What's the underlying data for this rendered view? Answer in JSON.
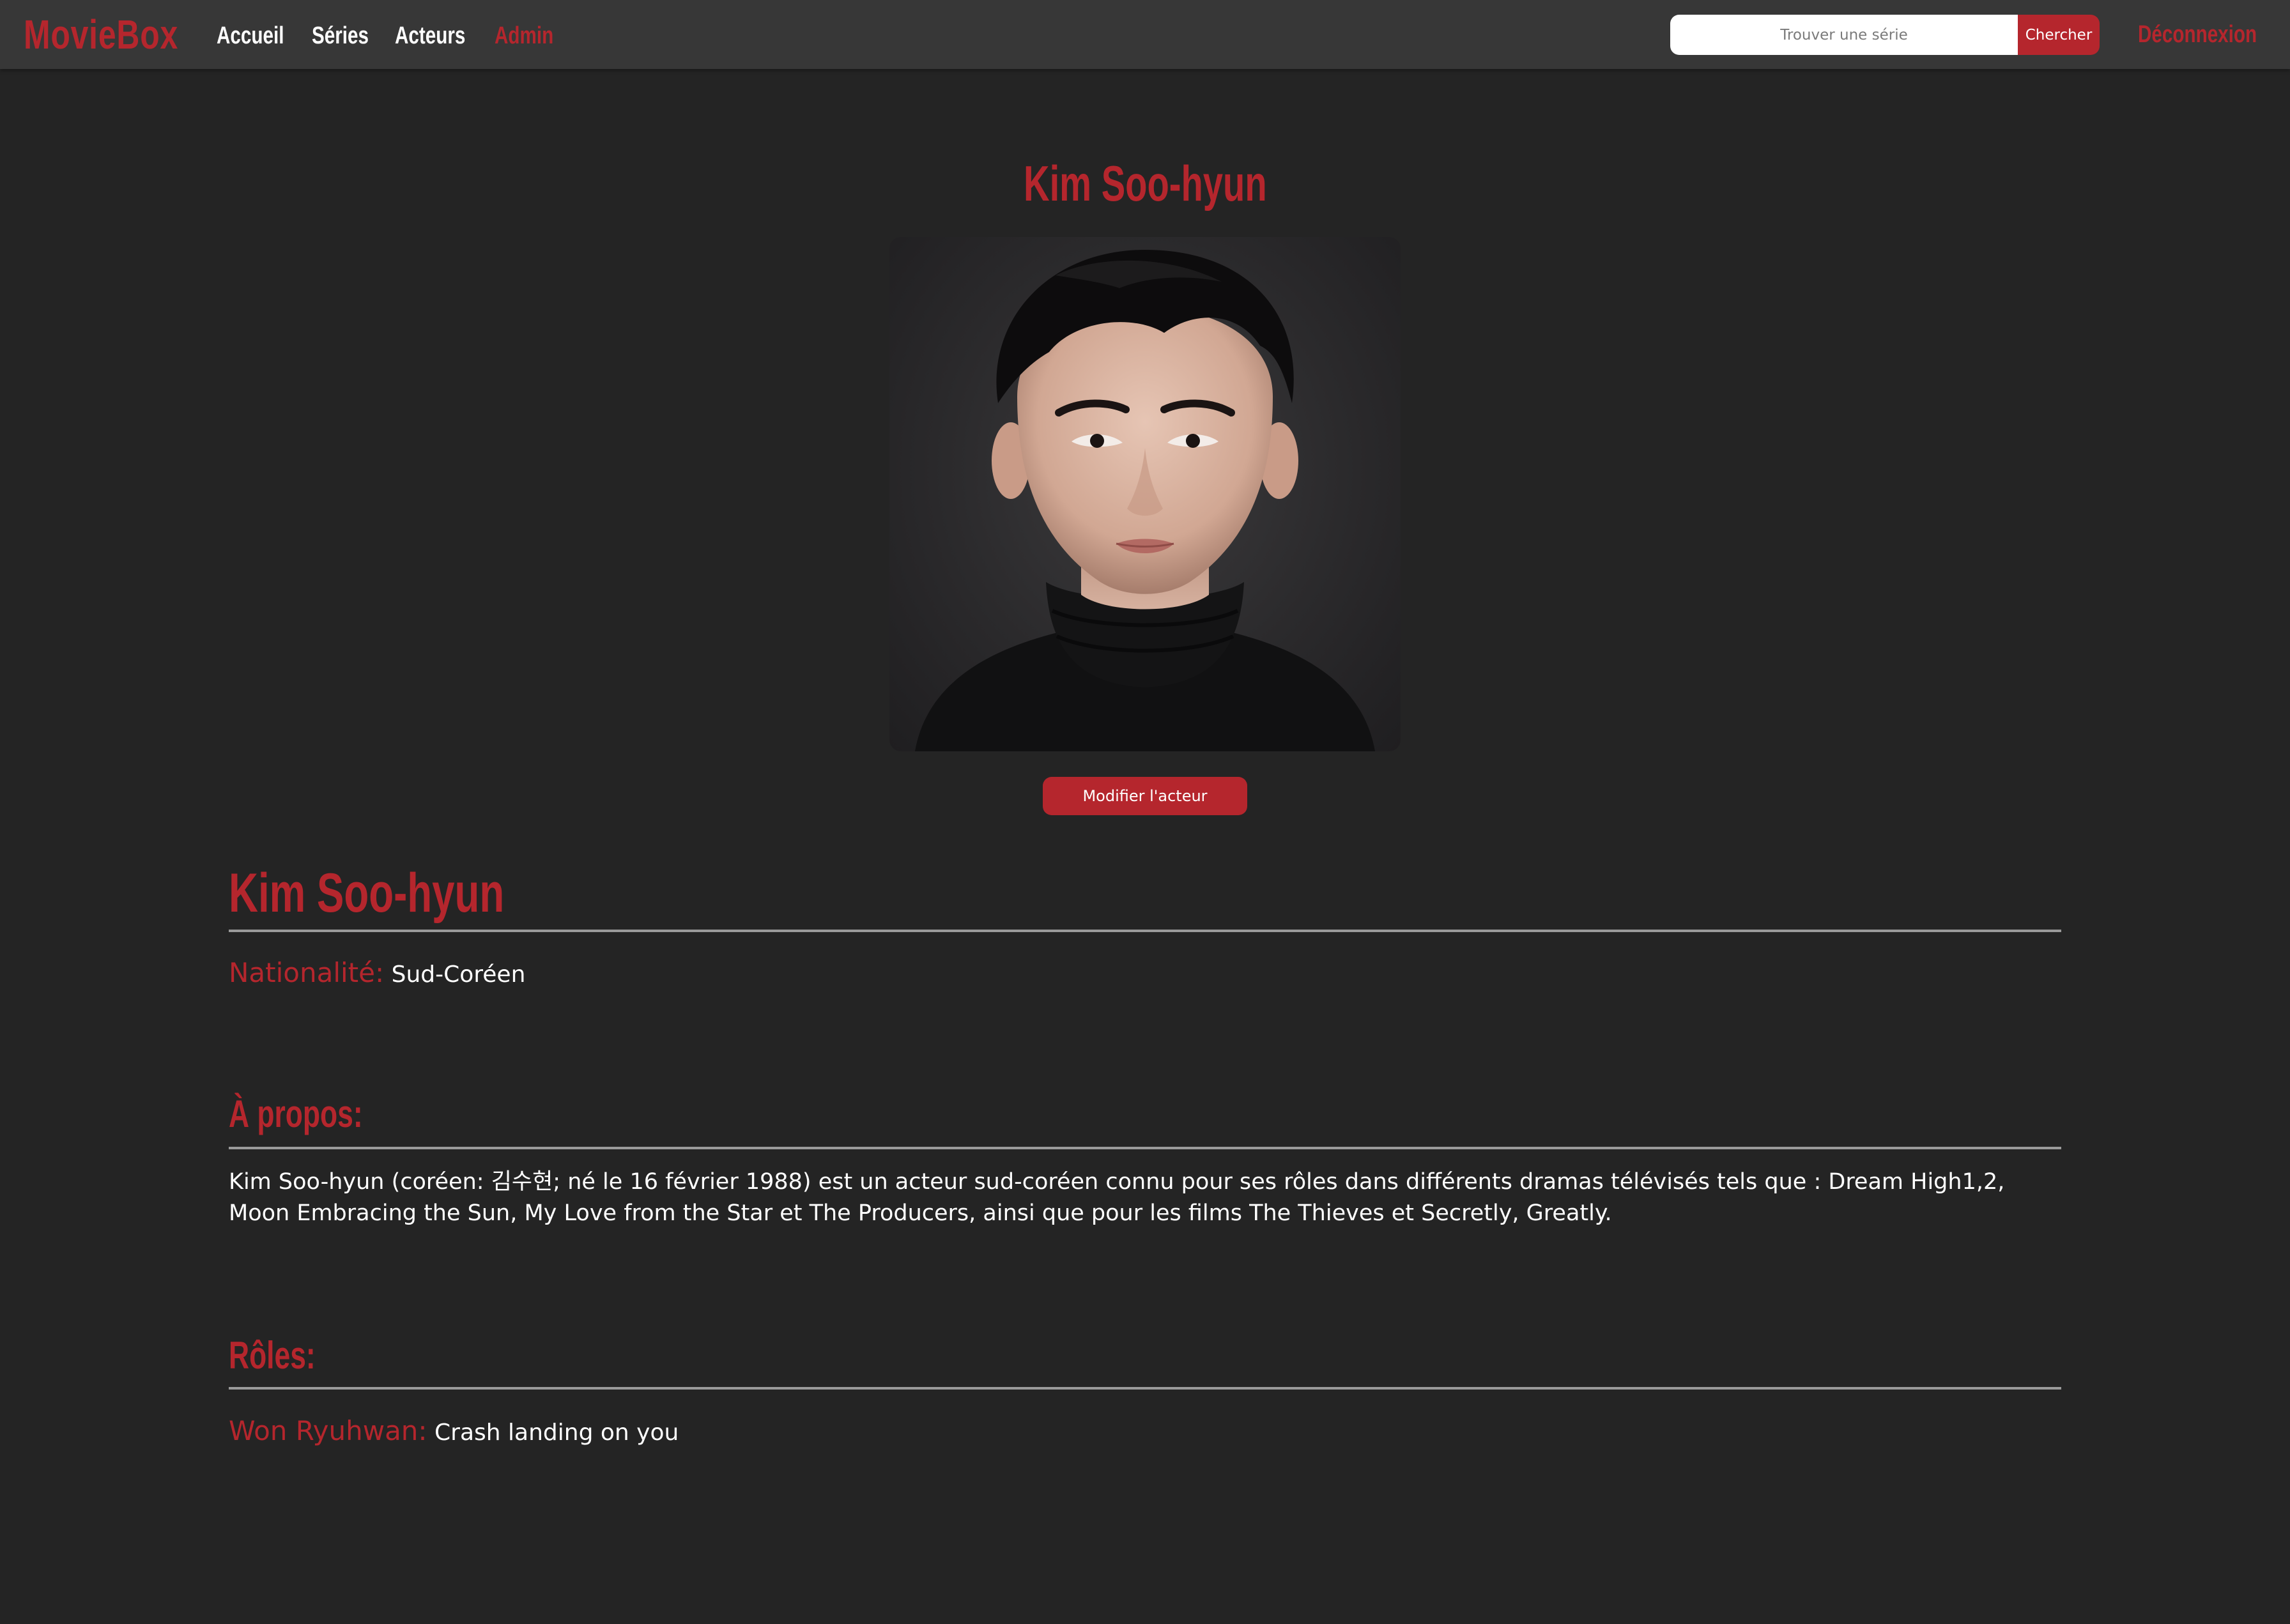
{
  "navbar": {
    "brand": "MovieBox",
    "links": [
      {
        "label": "Accueil"
      },
      {
        "label": "Séries"
      },
      {
        "label": "Acteurs"
      },
      {
        "label": "Admin"
      }
    ],
    "search": {
      "placeholder": "Trouver une série",
      "button_label": "Chercher"
    },
    "logout_label": "Déconnexion"
  },
  "actor": {
    "title": "Kim Soo-hyun",
    "portrait_alt": "Kim Soo-hyun",
    "edit_button_label": "Modifier l'acteur",
    "name_heading": "Kim Soo-hyun",
    "nationality": {
      "label": "Nationalité:",
      "value": "Sud-Coréen"
    },
    "about": {
      "heading": "À propos:",
      "text": "Kim Soo-hyun (coréen: 김수현; né le 16 février 1988) est un acteur sud-coréen connu pour ses rôles dans différents dramas télévisés tels que : Dream High1,2, Moon Embracing the Sun, My Love from the Star et The Producers, ainsi que pour les films The Thieves et Secretly, Greatly."
    },
    "roles": {
      "heading": "Rôles:",
      "items": [
        {
          "character": "Won Ryuhwan:",
          "series": "Crash landing on you"
        }
      ]
    }
  },
  "colors": {
    "accent": "#b5262d",
    "background": "#242424",
    "navbar": "#373737"
  }
}
